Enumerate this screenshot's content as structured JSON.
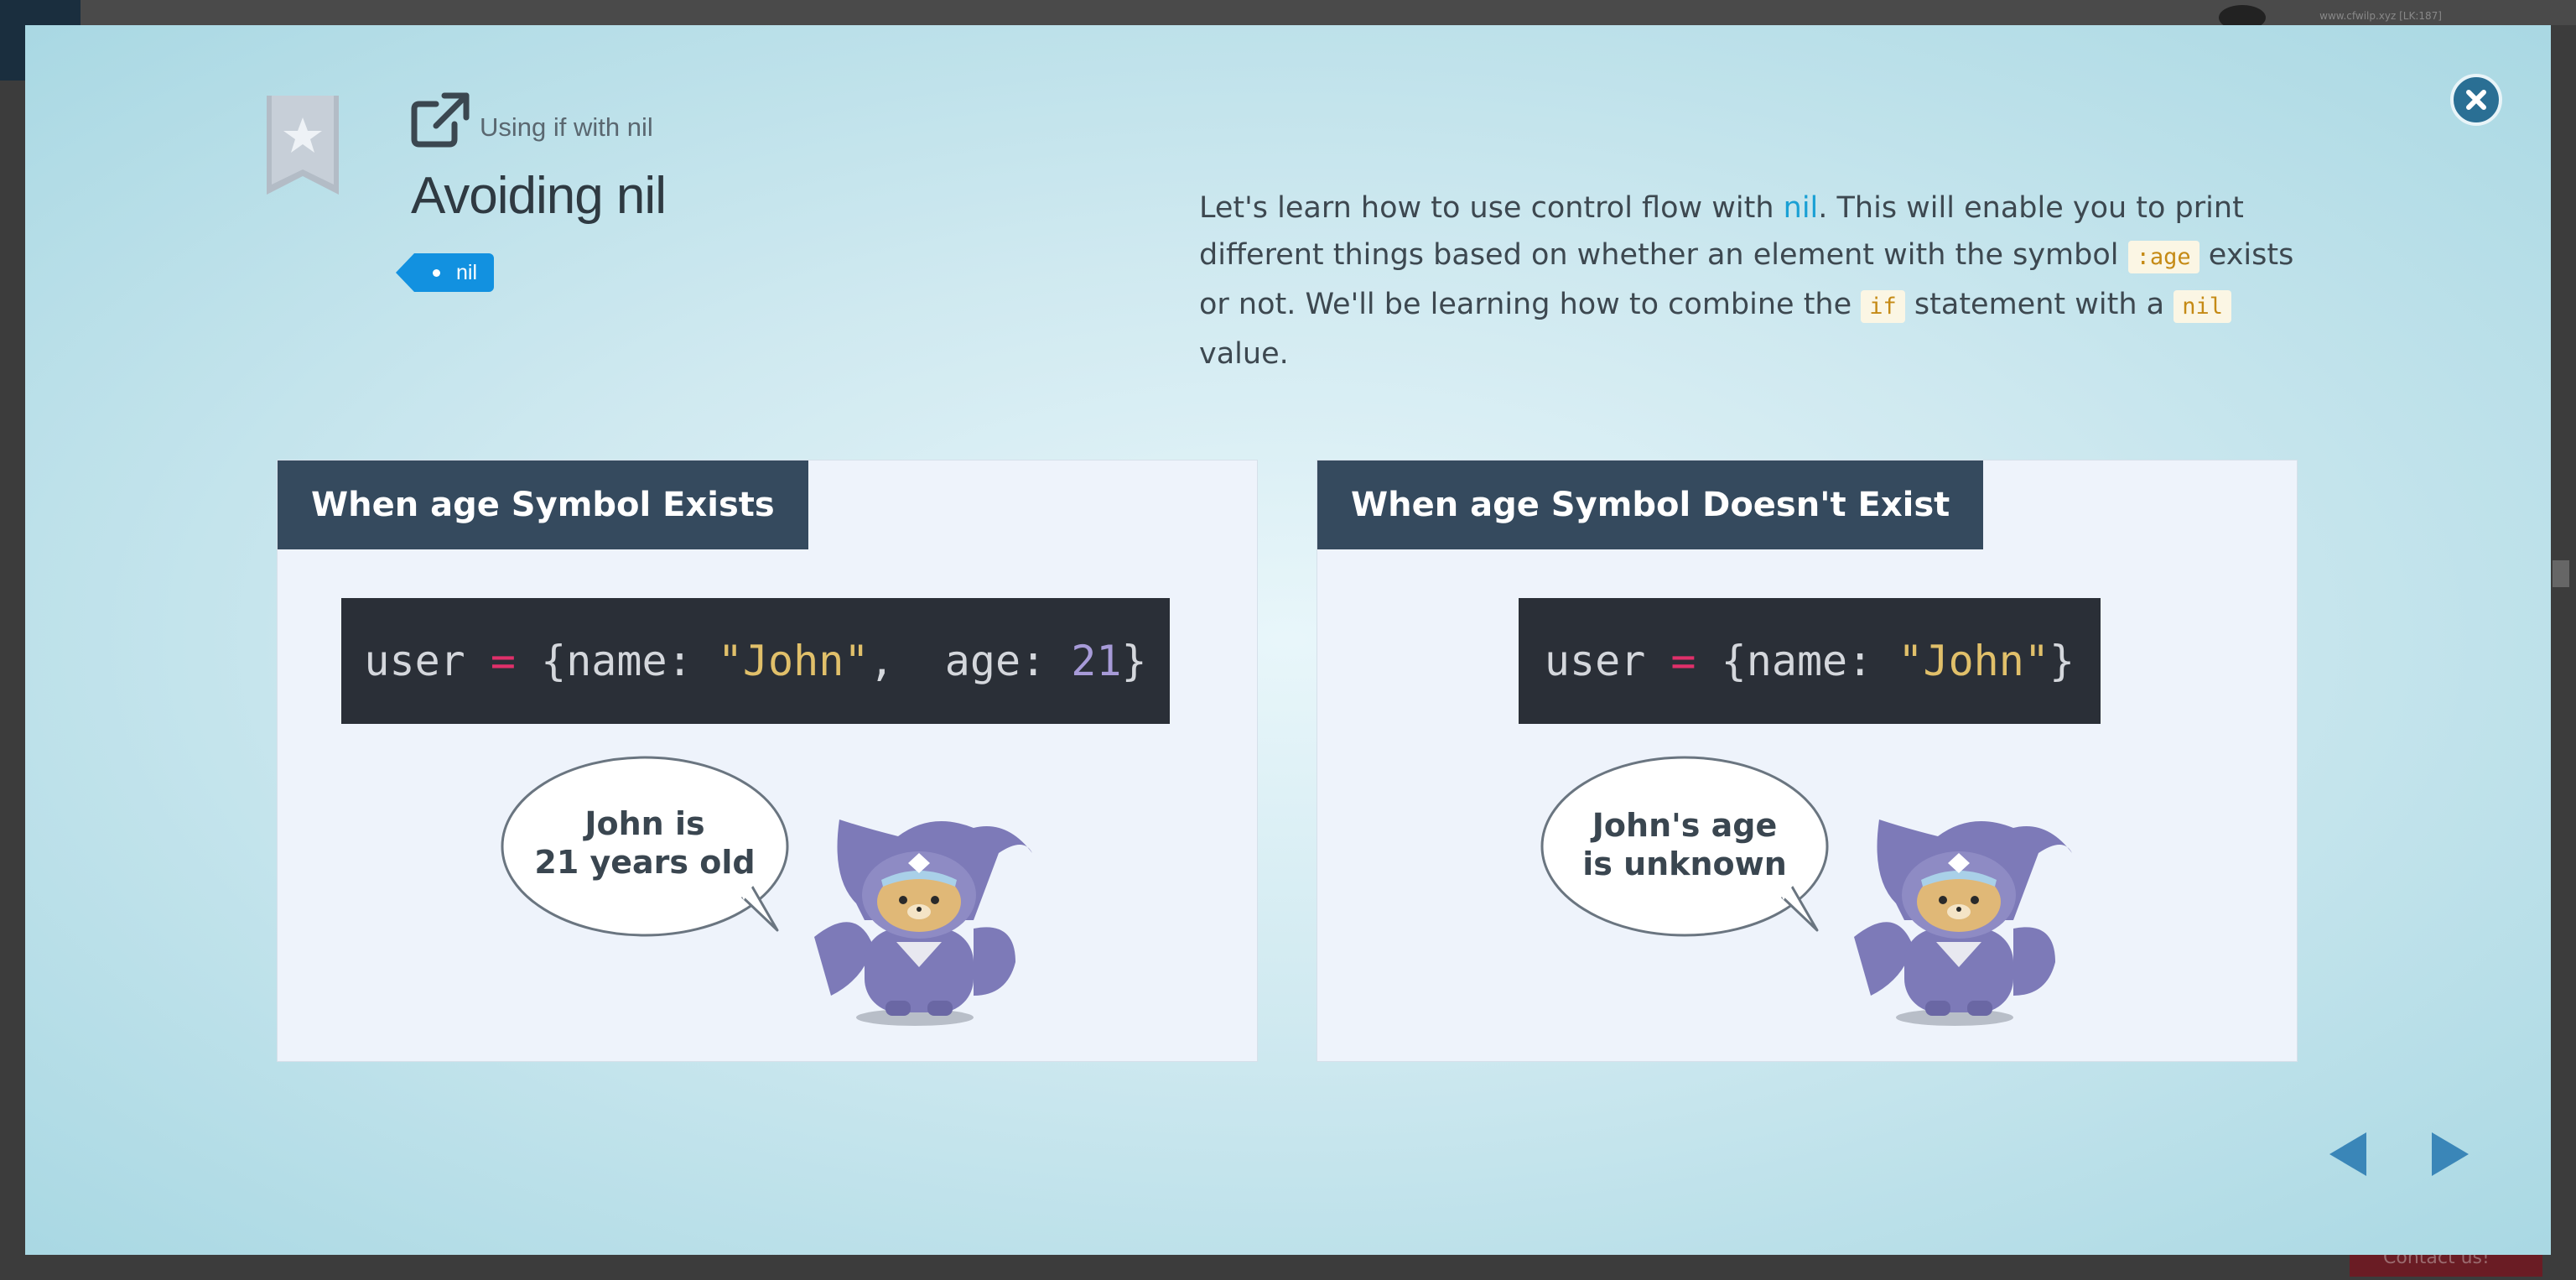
{
  "background": {
    "url_text": "www.cfwilp.xyz [LK:187]",
    "contact_label": "Contact us!"
  },
  "header": {
    "subtitle": "Using if with nil",
    "title": "Avoiding nil",
    "tag": "nil"
  },
  "description": {
    "p1": "Let's learn how to use control flow with ",
    "kw_nil": "nil",
    "p2": ". This will enable you to print different things based on whether an element with the symbol ",
    "code_age": ":age",
    "p3": " exists or not. We'll be learning how to combine the ",
    "code_if": "if",
    "p4": " statement with a ",
    "code_nil": "nil",
    "p5": " value."
  },
  "panels": [
    {
      "header": "When age Symbol Exists",
      "code": {
        "t1": "user ",
        "eq": "=",
        "t2": " {name: ",
        "str": "\"John\"",
        "t3": ",  age: ",
        "num": "21",
        "t4": "}"
      },
      "bubble": "John is\n21 years old"
    },
    {
      "header": "When age Symbol Doesn't Exist",
      "code": {
        "t1": "user ",
        "eq": "=",
        "t2": " {name: ",
        "str": "\"John\"",
        "t4": "}"
      },
      "bubble": "John's age\nis unknown"
    }
  ],
  "colors": {
    "accent": "#1291e0",
    "header_bg": "#354a5e",
    "code_bg": "#2a2f37",
    "close_btn": "#2a6f94",
    "nav_arrow": "#3a86b8"
  },
  "icons": {
    "bookmark": "star-bookmark-icon",
    "link": "external-link-icon",
    "close": "close-icon",
    "prev": "arrow-left-icon",
    "next": "arrow-right-icon"
  }
}
